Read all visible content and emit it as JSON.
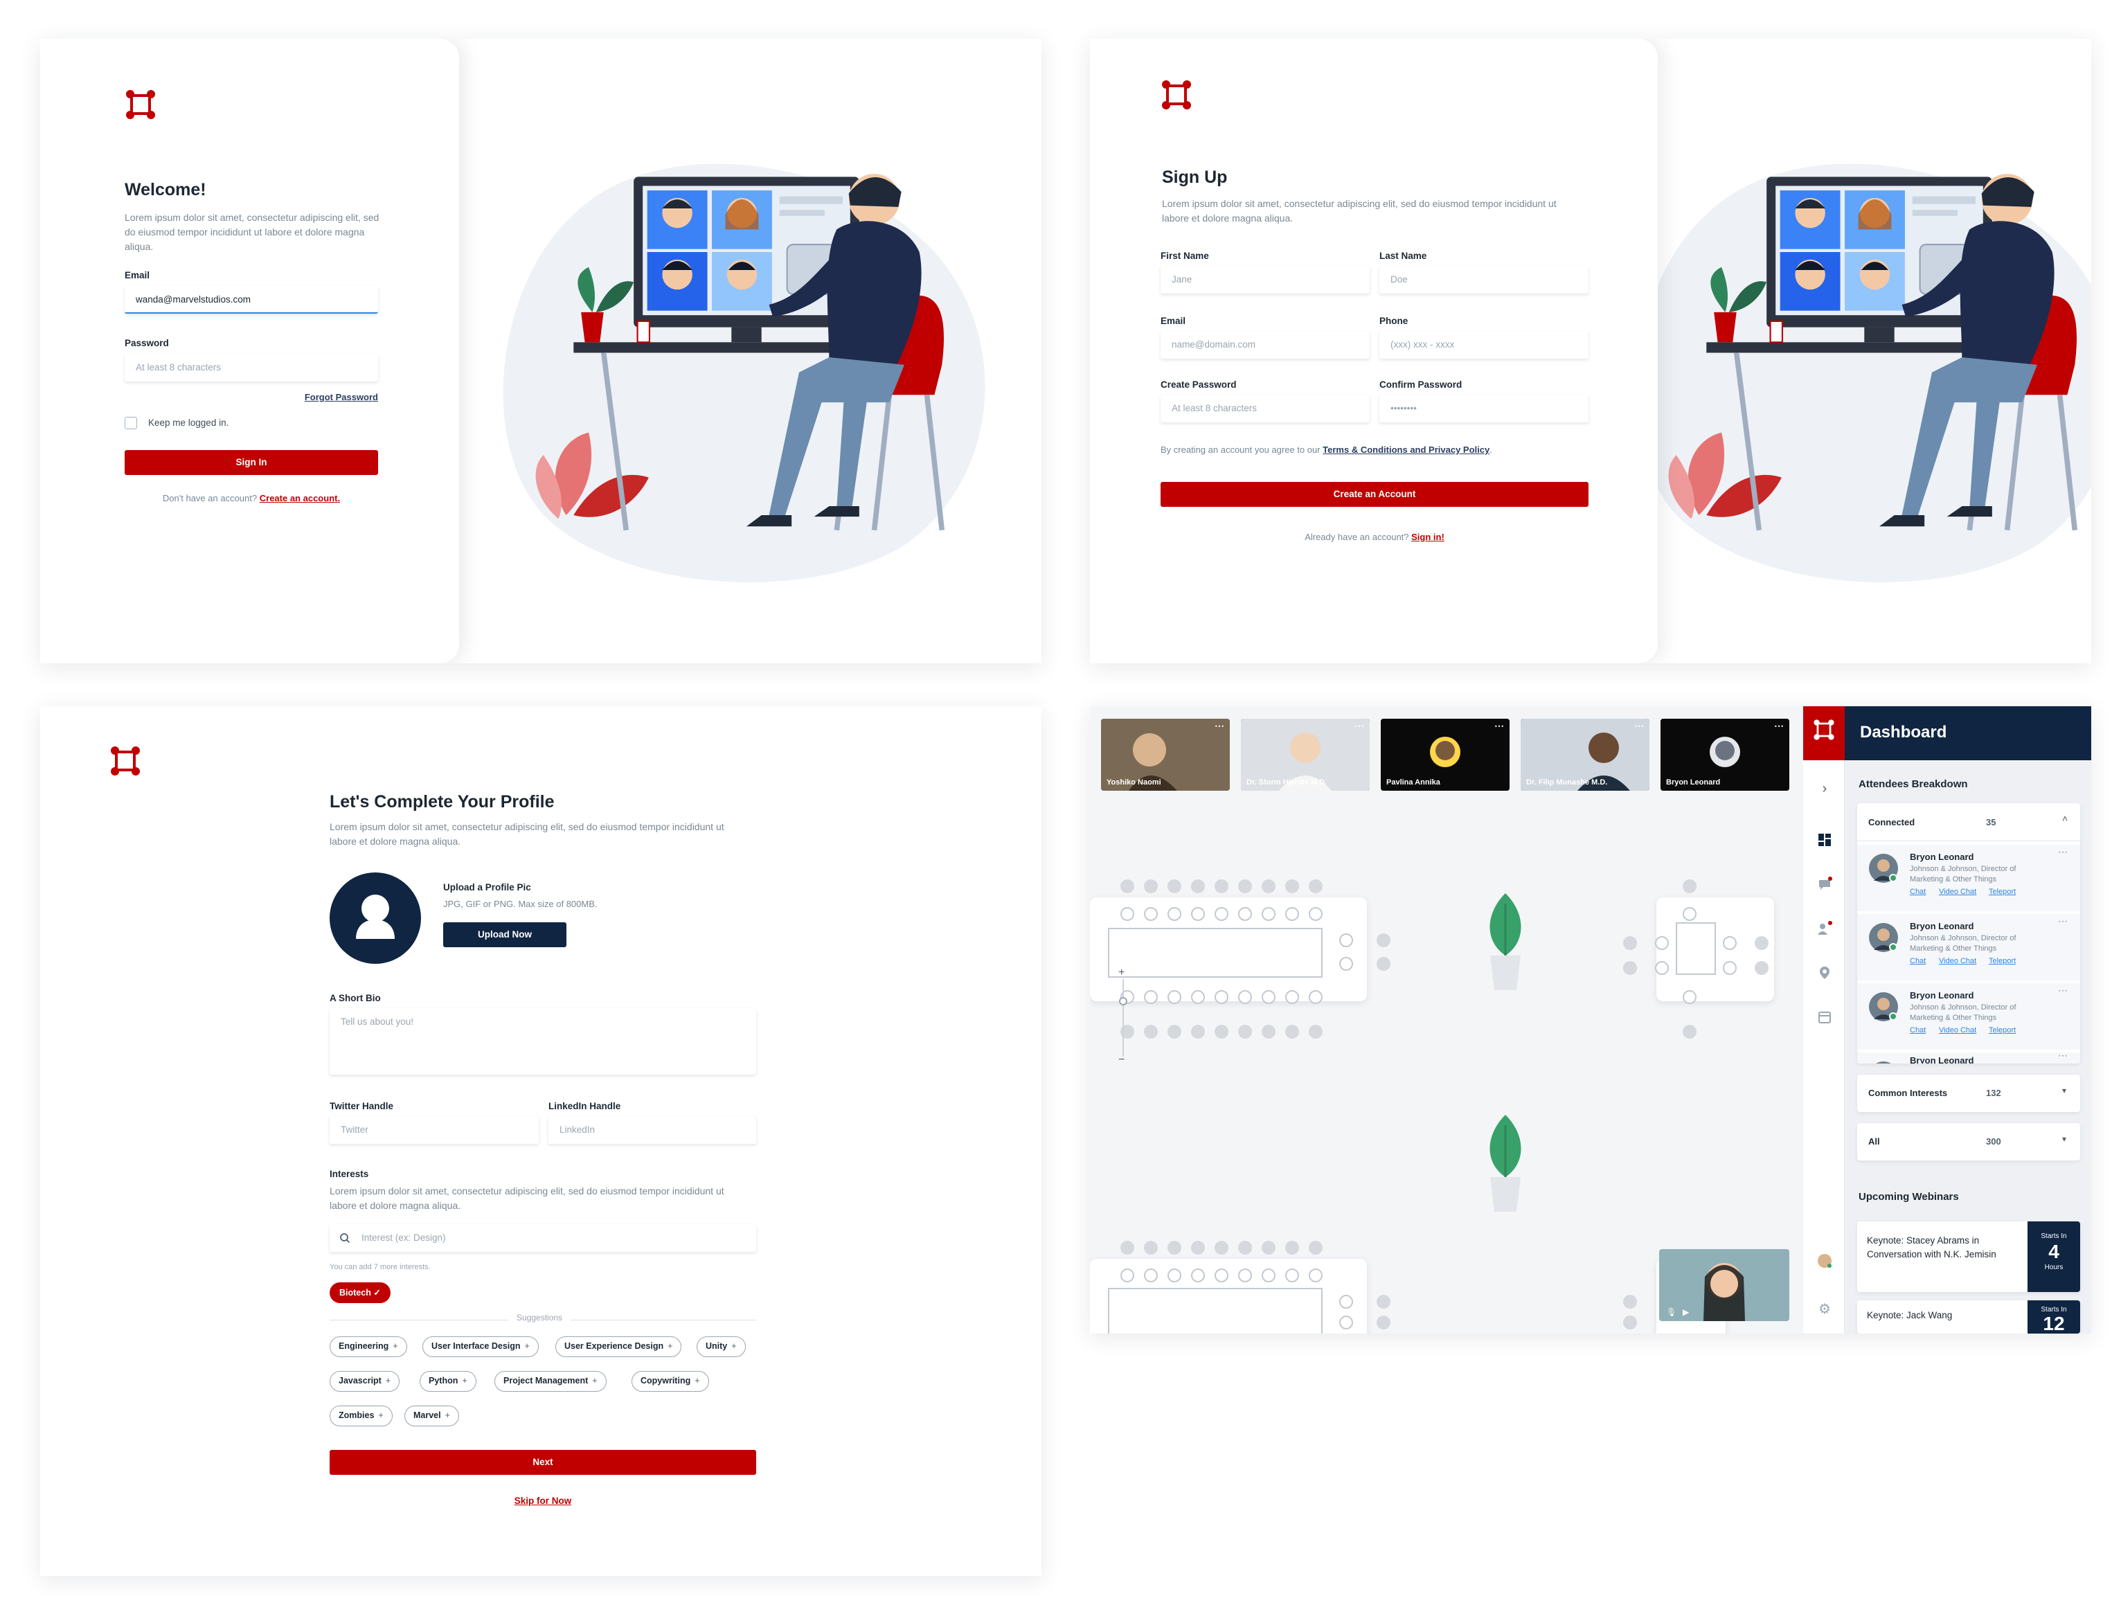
{
  "colors": {
    "brand_red": "#c00000",
    "navy": "#0f2542",
    "blob": "#eef2f6"
  },
  "login": {
    "title": "Welcome!",
    "description": "Lorem ipsum dolor sit amet, consectetur adipiscing elit, sed do eiusmod tempor incididunt ut labore et dolore magna aliqua.",
    "email_label": "Email",
    "email_value": "wanda@marvelstudios.com",
    "password_label": "Password",
    "password_placeholder": "At least 8 characters",
    "forgot_password": "Forgot Password",
    "keep_logged_in": "Keep me logged in.",
    "sign_in_button": "Sign In",
    "no_account_text": "Don't have an account?",
    "create_account_link": "Create an account."
  },
  "signup": {
    "title": "Sign Up",
    "description": "Lorem ipsum dolor sit amet, consectetur adipiscing elit, sed do eiusmod tempor incididunt ut labore et dolore magna aliqua.",
    "first_name_label": "First Name",
    "first_name_placeholder": "Jane",
    "last_name_label": "Last Name",
    "last_name_placeholder": "Doe",
    "email_label": "Email",
    "email_placeholder": "name@domain.com",
    "phone_label": "Phone",
    "phone_placeholder": "(xxx) xxx - xxxx",
    "create_password_label": "Create Password",
    "create_password_placeholder": "At least 8 characters",
    "confirm_password_label": "Confirm Password",
    "confirm_password_value": "••••••••",
    "terms_prefix": "By creating an account you agree to our",
    "terms_link": "Terms & Conditions and Privacy Policy",
    "terms_suffix": ".",
    "create_button": "Create an Account",
    "have_account_text": "Already have an account?",
    "sign_in_link": "Sign in!"
  },
  "profile": {
    "title": "Let's Complete Your Profile",
    "description": "Lorem ipsum dolor sit amet, consectetur adipiscing elit, sed do eiusmod tempor incididunt ut labore et dolore magna aliqua.",
    "upload_title": "Upload a Profile Pic",
    "upload_hint": "JPG, GIF or PNG. Max size of 800MB.",
    "upload_button": "Upload Now",
    "bio_label": "A Short Bio",
    "bio_placeholder": "Tell us about you!",
    "twitter_label": "Twitter Handle",
    "twitter_placeholder": "Twitter",
    "linkedin_label": "LinkedIn Handle",
    "linkedin_placeholder": "LinkedIn",
    "interests_label": "Interests",
    "interests_description": "Lorem ipsum dolor sit amet, consectetur adipiscing elit, sed do eiusmod tempor incididunt ut labore et dolore magna aliqua.",
    "interest_placeholder": "Interest (ex: Design)",
    "interest_hint": "You can add 7 more interests.",
    "selected_interest": "Biotech",
    "suggestions_label": "Suggestions",
    "suggestions": [
      "Engineering",
      "User Interface Design",
      "User Experience Design",
      "Unity",
      "Javascript",
      "Python",
      "Project Management",
      "Copywriting",
      "Zombies",
      "Marvel"
    ],
    "next_button": "Next",
    "skip_link": "Skip for Now"
  },
  "dashboard": {
    "title": "Dashboard",
    "video_tiles": [
      "Yoshiko Naomi",
      "Dr. Storm Hjerdis M.D.",
      "Pavlina Annika",
      "Dr. Filip Munashe M.D.",
      "Bryon Leonard"
    ],
    "attendees_title": "Attendees Breakdown",
    "connected_label": "Connected",
    "connected_count": "35",
    "attendees": [
      {
        "name": "Bryon Leonard",
        "role": "Johnson & Johnson, Director of Marketing & Other Things",
        "links": [
          "Chat",
          "Video Chat",
          "Teleport"
        ]
      },
      {
        "name": "Bryon Leonard",
        "role": "Johnson & Johnson, Director of Marketing & Other Things",
        "links": [
          "Chat",
          "Video Chat",
          "Teleport"
        ]
      },
      {
        "name": "Bryon Leonard",
        "role": "Johnson & Johnson, Director of Marketing & Other Things",
        "links": [
          "Chat",
          "Video Chat",
          "Teleport"
        ]
      },
      {
        "name": "Bryon Leonard"
      }
    ],
    "common_interests_label": "Common Interests",
    "common_interests_count": "132",
    "all_label": "All",
    "all_count": "300",
    "webinars_title": "Upcoming Webinars",
    "webinars": [
      {
        "title": "Keynote: Stacey Abrams in Conversation with N.K. Jemisin",
        "starts_in": "Starts In",
        "value": "4",
        "unit": "Hours"
      },
      {
        "title": "Keynote: Jack Wang",
        "starts_in": "Starts In",
        "value": "12",
        "unit": ""
      }
    ],
    "zoom_plus": "+",
    "zoom_minus": "−"
  }
}
